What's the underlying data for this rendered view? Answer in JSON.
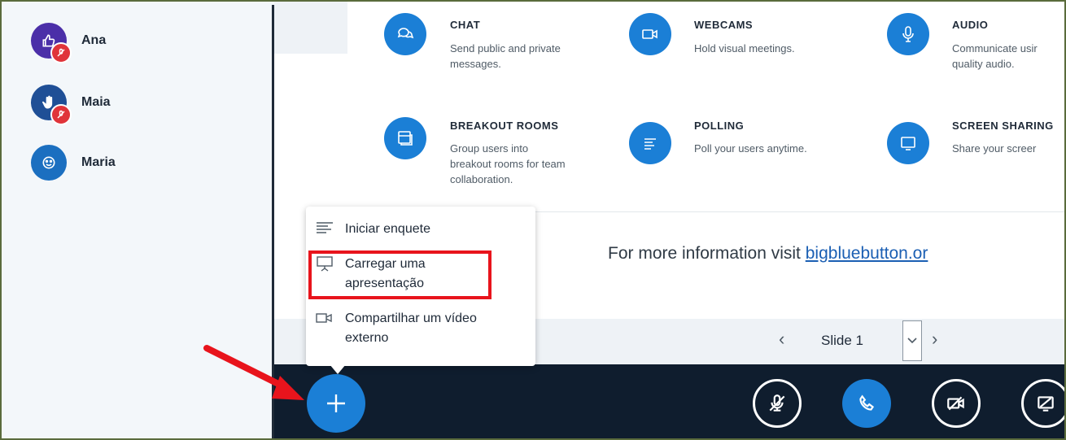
{
  "users": [
    {
      "name": "Ana",
      "avatar_color": "#4b2fa8",
      "icon": "thumbs-up-icon",
      "muted": true
    },
    {
      "name": "Maia",
      "avatar_color": "#1f4f96",
      "icon": "raised-hand-icon",
      "muted": true
    },
    {
      "name": "Maria",
      "avatar_color": "#1b6fc0",
      "icon": "smiley-icon",
      "muted": false
    }
  ],
  "features": [
    {
      "title": "CHAT",
      "desc": "Send public and private\nmessages.",
      "icon": "chat-icon"
    },
    {
      "title": "WEBCAMS",
      "desc": "Hold visual meetings.",
      "icon": "webcam-icon"
    },
    {
      "title": "AUDIO",
      "desc": "Communicate usir\nquality audio.",
      "icon": "microphone-icon"
    },
    {
      "title": "BREAKOUT ROOMS",
      "desc": "Group users into\nbreakout rooms for team\ncollaboration.",
      "icon": "breakout-rooms-icon"
    },
    {
      "title": "POLLING",
      "desc": "Poll your users anytime.",
      "icon": "polling-icon"
    },
    {
      "title": "SCREEN SHARING",
      "desc": "Share your screer",
      "icon": "screen-share-icon"
    }
  ],
  "info": {
    "prefix": "For more information visit ",
    "link": "bigbluebutton.or"
  },
  "slide": {
    "label": "Slide 1",
    "prev": "‹",
    "next": "›"
  },
  "menu": {
    "items": [
      {
        "label": "Iniciar enquete",
        "icon": "poll-list-icon"
      },
      {
        "label": "Carregar uma\napresentação",
        "icon": "presentation-icon"
      },
      {
        "label": "Compartilhar um vídeo\nexterno",
        "icon": "video-icon"
      }
    ]
  },
  "colors": {
    "accent": "#1b7fd6",
    "actionbar": "#0f1d2e",
    "highlight": "#e8141c",
    "muted_badge": "#e0343a"
  }
}
